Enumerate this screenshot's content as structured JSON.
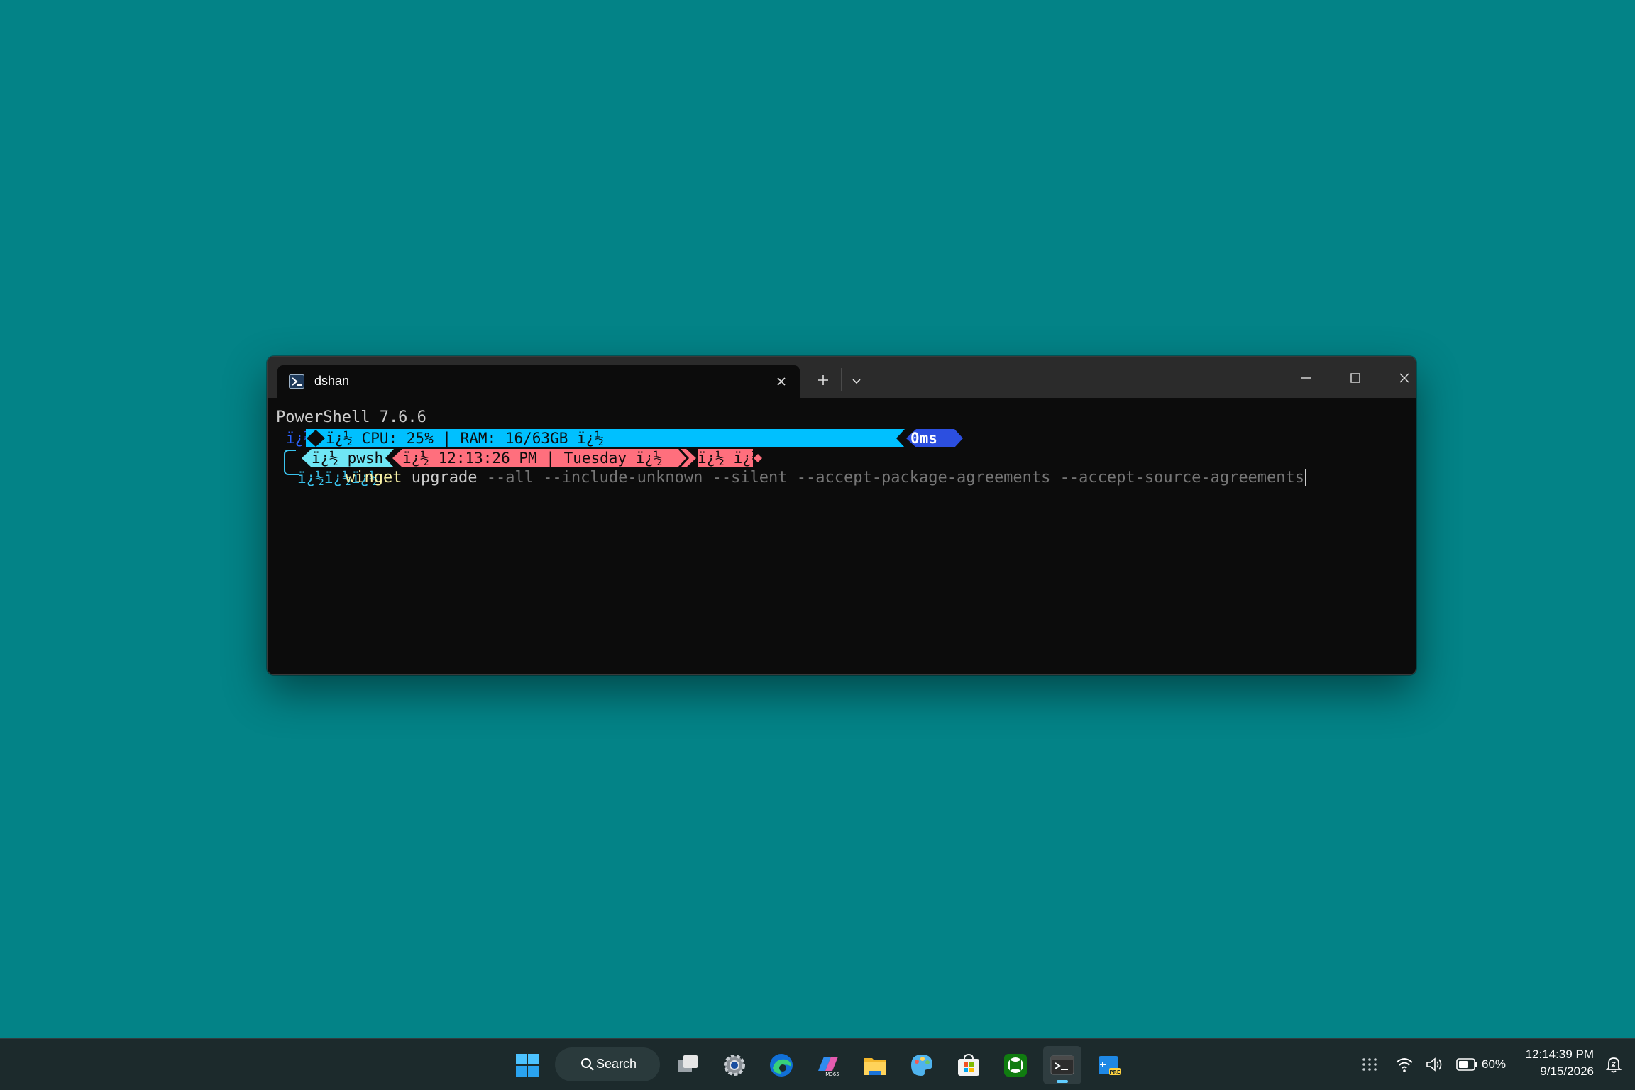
{
  "window": {
    "tab": {
      "title": "dshan",
      "icon": "powershell-icon"
    },
    "controls": [
      "minimize-icon",
      "maximize-icon",
      "close-icon"
    ]
  },
  "terminal": {
    "banner": "PowerShell 7.6.6",
    "prompt1": {
      "lead_glyph": "ï¿½",
      "sys_segment": "ï¿½ CPU: 25% | RAM: 16/63GB ï¿½",
      "duration": "0ms"
    },
    "prompt2": {
      "shell_segment": "ï¿½ pwsh",
      "time_segment": "ï¿½ 12:13:26 PM | Tuesday ï¿½",
      "status_segment": "ï¿½ ï¿½"
    },
    "prompt3": {
      "arrows": "ï¿½ï¿½ï¿½",
      "command": "winget",
      "subcommand": "upgrade",
      "args": "--all --include-unknown --silent --accept-package-agreements --accept-source-agreements"
    },
    "colors": {
      "cyan": "#00c0ff",
      "blue": "#2c4fe0",
      "light_cyan": "#6fe6f5",
      "pink": "#ff6f7d",
      "command_yellow": "#f9f1a5",
      "args_gray": "#767676"
    }
  },
  "taskbar": {
    "search_label": "Search",
    "apps": [
      "start-icon",
      "task-view-icon",
      "settings-icon",
      "edge-icon",
      "m365-copilot-icon",
      "file-explorer-icon",
      "paint-icon",
      "store-icon",
      "xbox-icon",
      "terminal-icon",
      "terminal-preview-icon"
    ],
    "battery": "60%",
    "time": "12:14:39 PM",
    "date": "9/15/2026"
  }
}
